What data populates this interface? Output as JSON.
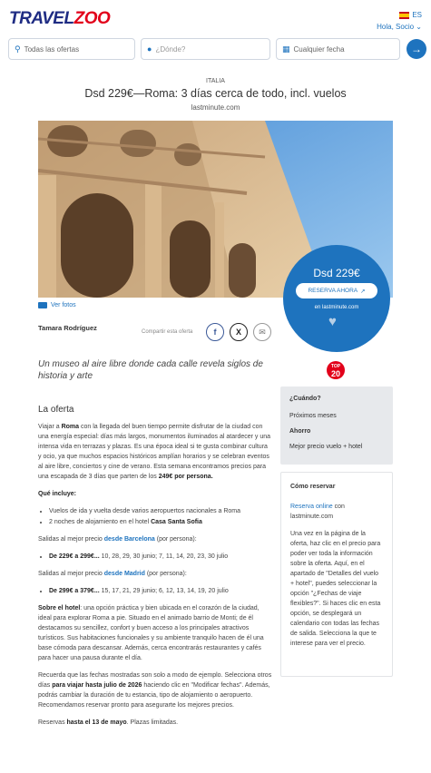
{
  "header": {
    "logo": "TRAVELZOO",
    "lang": "ES",
    "greeting": "Hola, Socio"
  },
  "search": {
    "offers_label": "Todas las ofertas",
    "where_placeholder": "¿Dónde?",
    "date_label": "Cualquier fecha"
  },
  "deal": {
    "country": "ITALIA",
    "title": "Dsd 229€—Roma: 3 días cerca de todo, incl. vuelos",
    "provider": "lastminute.com",
    "see_photos": "Ver fotos",
    "price": "Dsd 229€",
    "reserve_label": "RESERVA AHORA",
    "on_site": "en lastminute.com",
    "author": "Tamara Rodríguez",
    "share_label": "Compartir esta oferta",
    "tagline": "Un museo al aire libre donde cada calle revela siglos de historia y arte",
    "badge_top": "TOP",
    "badge_num": "20"
  },
  "body": {
    "heading": "La oferta",
    "p1_a": "Viajar a ",
    "p1_b": "Roma",
    "p1_c": " con la llegada del buen tiempo permite disfrutar de la ciudad con una energía especial: días más largos, monumentos iluminados al atardecer y una intensa vida en terrazas y plazas. Es una época ideal si te gusta combinar cultura y ocio, ya que muchos espacios históricos amplían horarios y se celebran eventos al aire libre, conciertos y cine de verano. Esta semana encontramos precios para una escapada de 3 días que parten de los ",
    "p1_d": "249€ por persona.",
    "includes_heading": "Qué incluye:",
    "include1": "Vuelos de ida y vuelta desde varios aeropuertos nacionales a Roma",
    "include2_a": "2 noches de alojamiento en el hotel ",
    "include2_b": "Casa Santa Sofia",
    "bcn_a": "Salidas al mejor precio ",
    "bcn_b": "desde Barcelona",
    "bcn_c": " (por persona):",
    "bcn_price": "De 229€ a 299€...",
    "bcn_dates": " 10, 28, 29, 30 junio; 7, 11, 14, 20, 23, 30 julio",
    "mad_a": "Salidas al mejor precio ",
    "mad_b": "desde Madrid",
    "mad_c": " (por persona):",
    "mad_price": "De 299€ a 379€...",
    "mad_dates": " 15, 17, 21, 29 junio; 6, 12, 13, 14, 19, 20 julio",
    "hotel_a": "Sobre el hotel",
    "hotel_b": ": una opción práctica y bien ubicada en el corazón de la ciudad, ideal para explorar Roma a pie. Situado en el animado barrio de Monti; de él destacamos su sencillez, confort y buen acceso a los principales atractivos turísticos. Sus habitaciones funcionales y su ambiente tranquilo hacen de él una base cómoda para descansar. Además, cerca encontrarás restaurantes y cafés para hacer una pausa durante el día.",
    "note_a": "Recuerda que las fechas mostradas son solo a modo de ejemplo. Selecciona otros días ",
    "note_b": "para viajar hasta julio de 2026",
    "note_c": " haciendo clic en \"Modificar fechas\". Además, podrás cambiar la duración de tu estancia, tipo de alojamiento o aeropuerto. Recomendamos reservar pronto para asegurarte los mejores precios.",
    "until_a": "Reservas ",
    "until_b": "hasta el 13 de mayo",
    "until_c": ". Plazas limitadas."
  },
  "sidebar": {
    "when_heading": "¿Cuándo?",
    "when_value": "Próximos meses",
    "save_heading": "Ahorro",
    "save_value": "Mejor precio vuelo + hotel",
    "howto_heading": "Cómo reservar",
    "howto_link": "Reserva online",
    "howto_link_rest": " con lastminute.com",
    "howto_text": "Una vez en la página de la oferta, haz clic en el precio para poder ver toda la información sobre la oferta. Aquí, en el apartado de \"Detalles del vuelo + hotel\", puedes seleccionar la opción \"¿Fechas de viaje flexibles?\". Si haces clic en esta opción, se desplegará un calendario con todas las fechas de salida. Selecciona la que te interese para ver el precio."
  },
  "colors": {
    "brand_blue": "#1e73be",
    "logo_navy": "#1f2c83",
    "logo_red": "#e2001a"
  }
}
